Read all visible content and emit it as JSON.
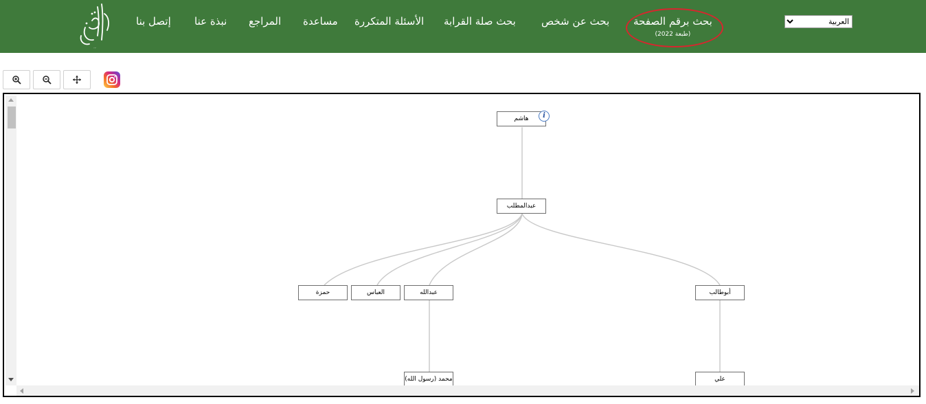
{
  "header": {
    "logo_text": "الهوشان",
    "nav": [
      {
        "label": "بحث برقم الصفحة",
        "sub": "(طبعة 2022)"
      },
      {
        "label": "بحث عن شخص"
      },
      {
        "label": "بحث صلة القرابة"
      },
      {
        "label": "الأسئلة المتكررة"
      },
      {
        "label": "مساعدة"
      },
      {
        "label": "المراجع"
      },
      {
        "label": "نبذة عنا"
      },
      {
        "label": "إتصل بنا"
      }
    ],
    "language": {
      "selected": "العربية"
    },
    "accent_color": "#3f7a3b",
    "highlight_color": "#d7262e"
  },
  "toolbar": {
    "zoom_in": "zoom-in-icon",
    "zoom_out": "zoom-out-icon",
    "center": "move-icon",
    "social": "instagram-icon"
  },
  "tree": {
    "info_label": "i",
    "nodes": {
      "hashim": "هاشم",
      "abdulmuttalib": "عبدالمطلب",
      "hamza": "حمزة",
      "abbas": "العباس",
      "abdullah": "عبدالله",
      "abutalib": "أبوطالب",
      "muhammad": "محمد (رسول الله)",
      "ali": "علي"
    }
  }
}
